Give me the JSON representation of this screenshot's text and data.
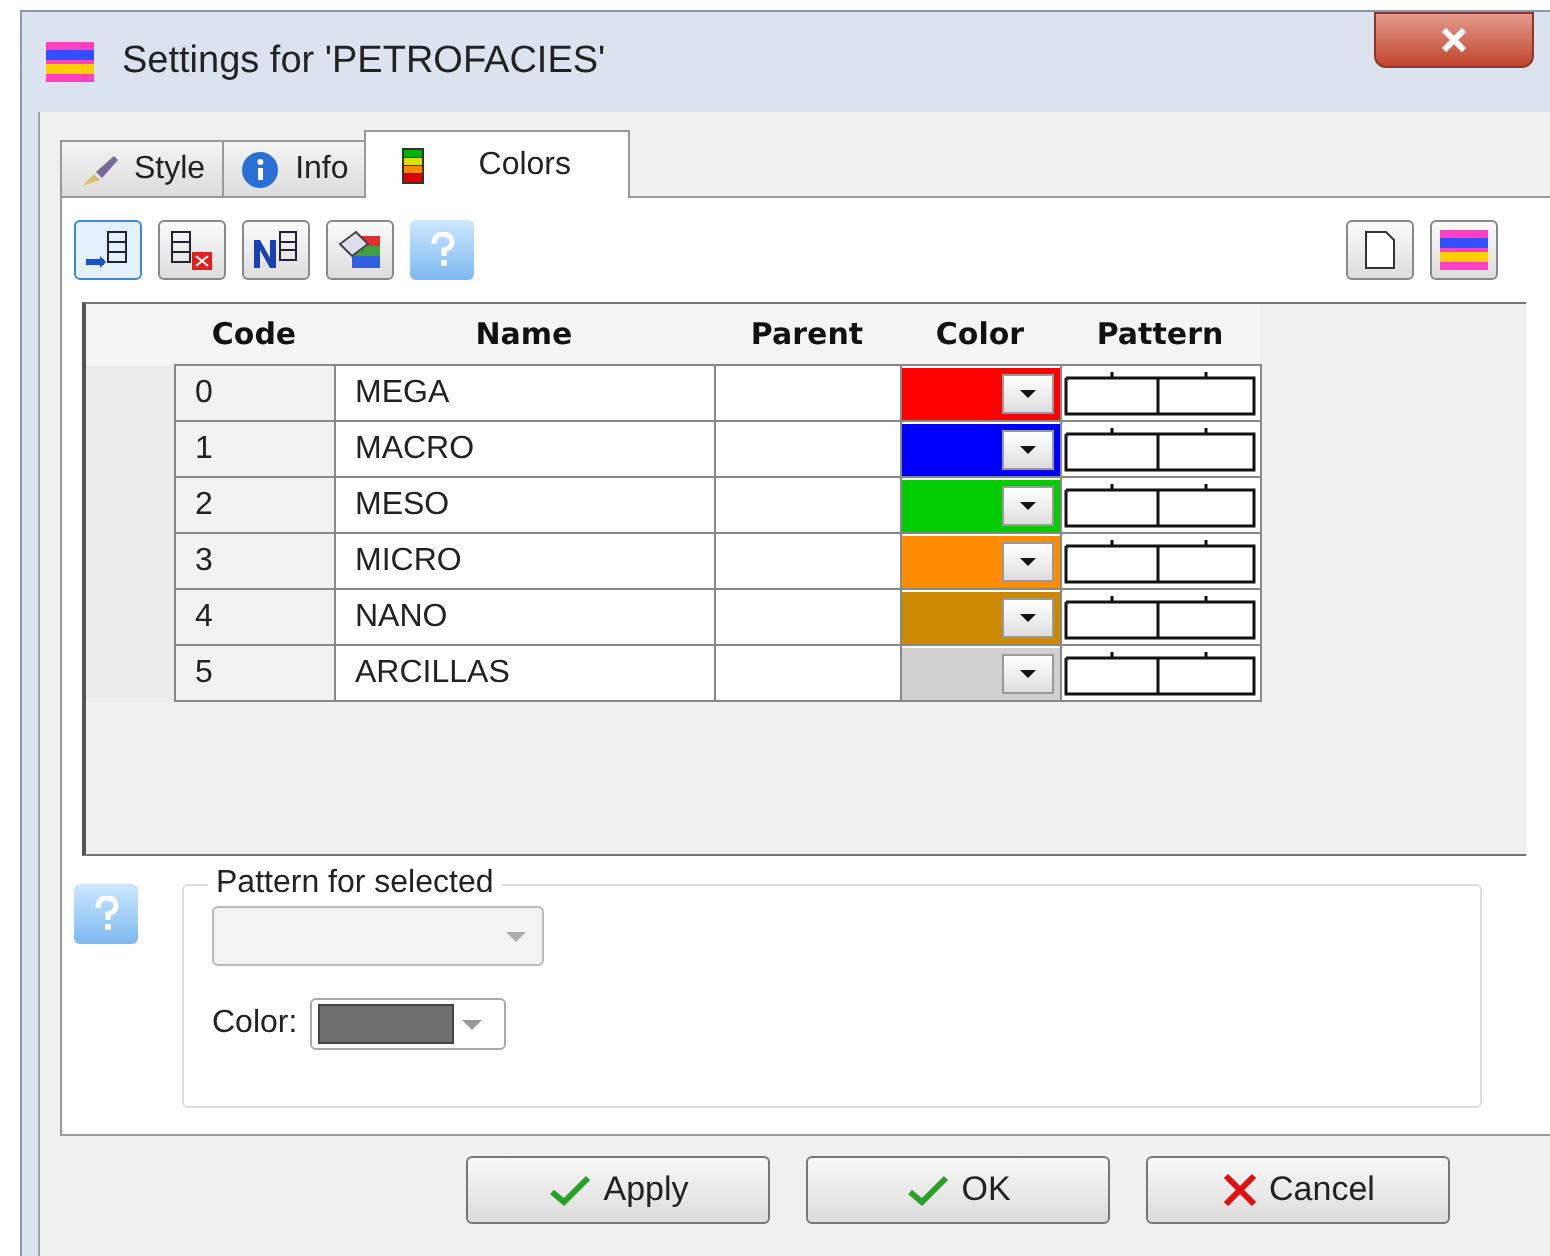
{
  "window": {
    "title": "Settings for 'PETROFACIES'"
  },
  "tabs": [
    {
      "label": "Style",
      "kind": "brush",
      "selected": false
    },
    {
      "label": "Info",
      "kind": "info",
      "selected": false
    },
    {
      "label": "Colors",
      "kind": "bars",
      "selected": true
    }
  ],
  "table": {
    "columns": [
      "Code",
      "Name",
      "Parent",
      "Color",
      "Pattern"
    ],
    "rows": [
      {
        "code": "0",
        "name": "MEGA",
        "color": "#ff0000"
      },
      {
        "code": "1",
        "name": "MACRO",
        "color": "#0000ff"
      },
      {
        "code": "2",
        "name": "MESO",
        "color": "#00cc00"
      },
      {
        "code": "3",
        "name": "MICRO",
        "color": "#ff8c00"
      },
      {
        "code": "4",
        "name": "NANO",
        "color": "#cc8800"
      },
      {
        "code": "5",
        "name": "ARCILLAS",
        "color": "#d0d0d0"
      }
    ]
  },
  "pattern_group": {
    "title": "Pattern for selected",
    "pattern_select": {
      "disabled": true
    },
    "color_label": "Color:"
  },
  "buttons": [
    {
      "label": "Apply",
      "kind": "check"
    },
    {
      "label": "OK",
      "kind": "check"
    },
    {
      "label": "Cancel",
      "kind": "cross"
    }
  ]
}
